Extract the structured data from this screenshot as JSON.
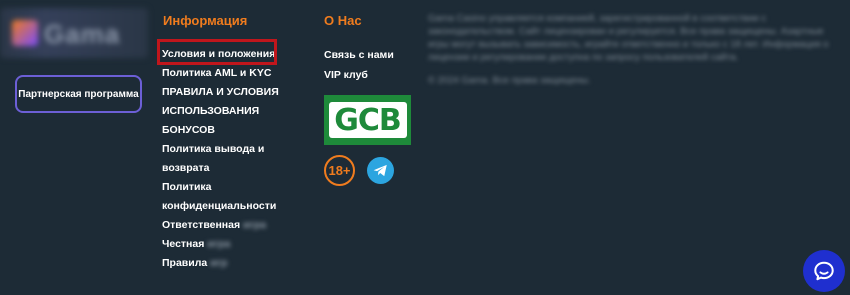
{
  "logo": {
    "text": "Gama"
  },
  "partner_button": {
    "label": "Партнерская программа"
  },
  "info": {
    "title": "Информация",
    "links": [
      {
        "label": "Условия и положения",
        "blur": ""
      },
      {
        "label": "Политика AML и KYC",
        "blur": ""
      },
      {
        "label": "ПРАВИЛА И УСЛОВИЯ ИСПОЛЬЗОВАНИЯ БОНУСОВ",
        "blur": ""
      },
      {
        "label": "Политика вывода и возврата",
        "blur": ""
      },
      {
        "label": "Политика конфиденциальности",
        "blur": ""
      },
      {
        "label": "Ответственная",
        "blur": "игра"
      },
      {
        "label": "Честная",
        "blur": "игра"
      },
      {
        "label": "Правила",
        "blur": "игр"
      }
    ]
  },
  "about": {
    "title": "О Нас",
    "links": [
      {
        "label": "Связь с нами"
      },
      {
        "label": "VIP клуб"
      }
    ]
  },
  "badges": {
    "gcb": "GCB",
    "age": "18+"
  },
  "disclaimer": {
    "paragraphs": [
      "Gama Casino управляется компанией, зарегистрированной в соответствии с законодательством. Сайт лицензирован и регулируется. Все права защищены. Азартные игры могут вызывать зависимость, играйте ответственно и только с 18 лет. Информация о лицензии и регулировании доступна по запросу пользователей сайта.",
      "© 2024 Gama. Все права защищены."
    ]
  },
  "colors": {
    "accent": "#f07c1e",
    "background": "#1d2b36",
    "highlight": "#c0161c",
    "chat": "#1f2fcf"
  }
}
